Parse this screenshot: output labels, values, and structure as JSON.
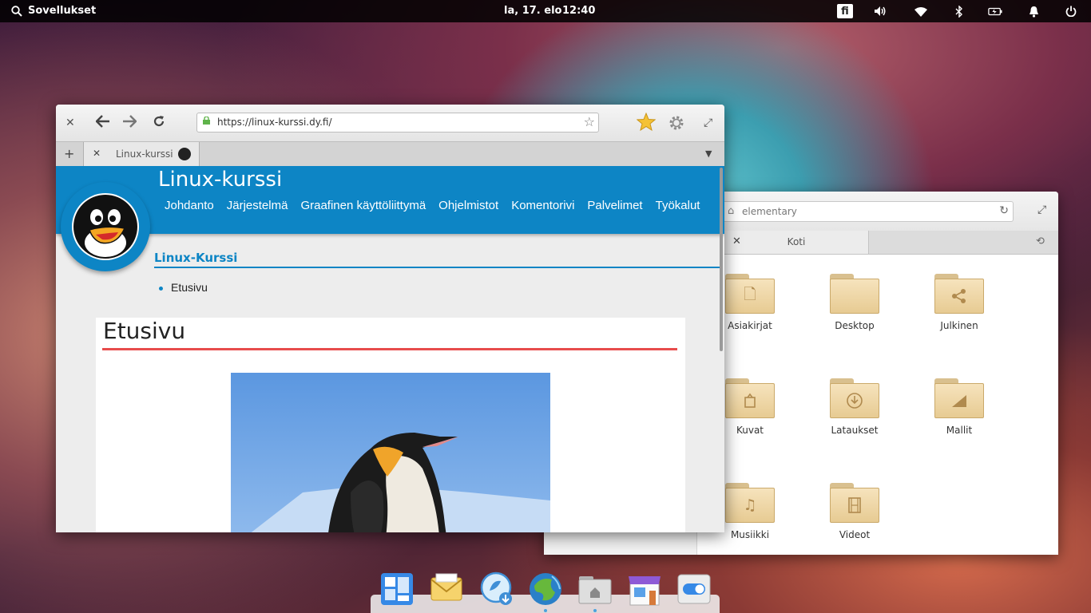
{
  "panel": {
    "applications_label": "Sovellukset",
    "date": "la, 17. elo",
    "time": "12:40",
    "language": "fi",
    "indicators": [
      "volume-icon",
      "wifi-icon",
      "bluetooth-icon",
      "battery-icon",
      "notifications-icon",
      "power-icon"
    ]
  },
  "files": {
    "breadcrumb": "elementary",
    "tab_label": "Koti",
    "folders": [
      {
        "label": "Asiakirjat",
        "icon": "document"
      },
      {
        "label": "Desktop",
        "icon": "plain"
      },
      {
        "label": "Julkinen",
        "icon": "share"
      },
      {
        "label": "Kuvat",
        "icon": "pictures"
      },
      {
        "label": "Lataukset",
        "icon": "download"
      },
      {
        "label": "Mallit",
        "icon": "templates"
      },
      {
        "label": "Musiikki",
        "icon": "music"
      },
      {
        "label": "Videot",
        "icon": "video"
      }
    ]
  },
  "browser": {
    "url": "https://linux-kurssi.dy.fi/",
    "tab_title": "Linux-kurssi",
    "site_title": "Linux-kurssi",
    "nav": [
      "Johdanto",
      "Järjestelmä",
      "Graafinen käyttöliittymä",
      "Ohjelmistot",
      "Komentorivi",
      "Palvelimet",
      "Työkalut"
    ],
    "section_title": "Linux-Kurssi",
    "breadcrumb_item": "Etusivu",
    "article_title": "Etusivu"
  },
  "dock": {
    "apps": [
      "multitasking-view",
      "mail",
      "appcenter-download",
      "web-browser",
      "files",
      "appcenter-store",
      "system-settings"
    ]
  },
  "colors": {
    "site_blue": "#0d85c5",
    "accent_red": "#e74c4c"
  }
}
